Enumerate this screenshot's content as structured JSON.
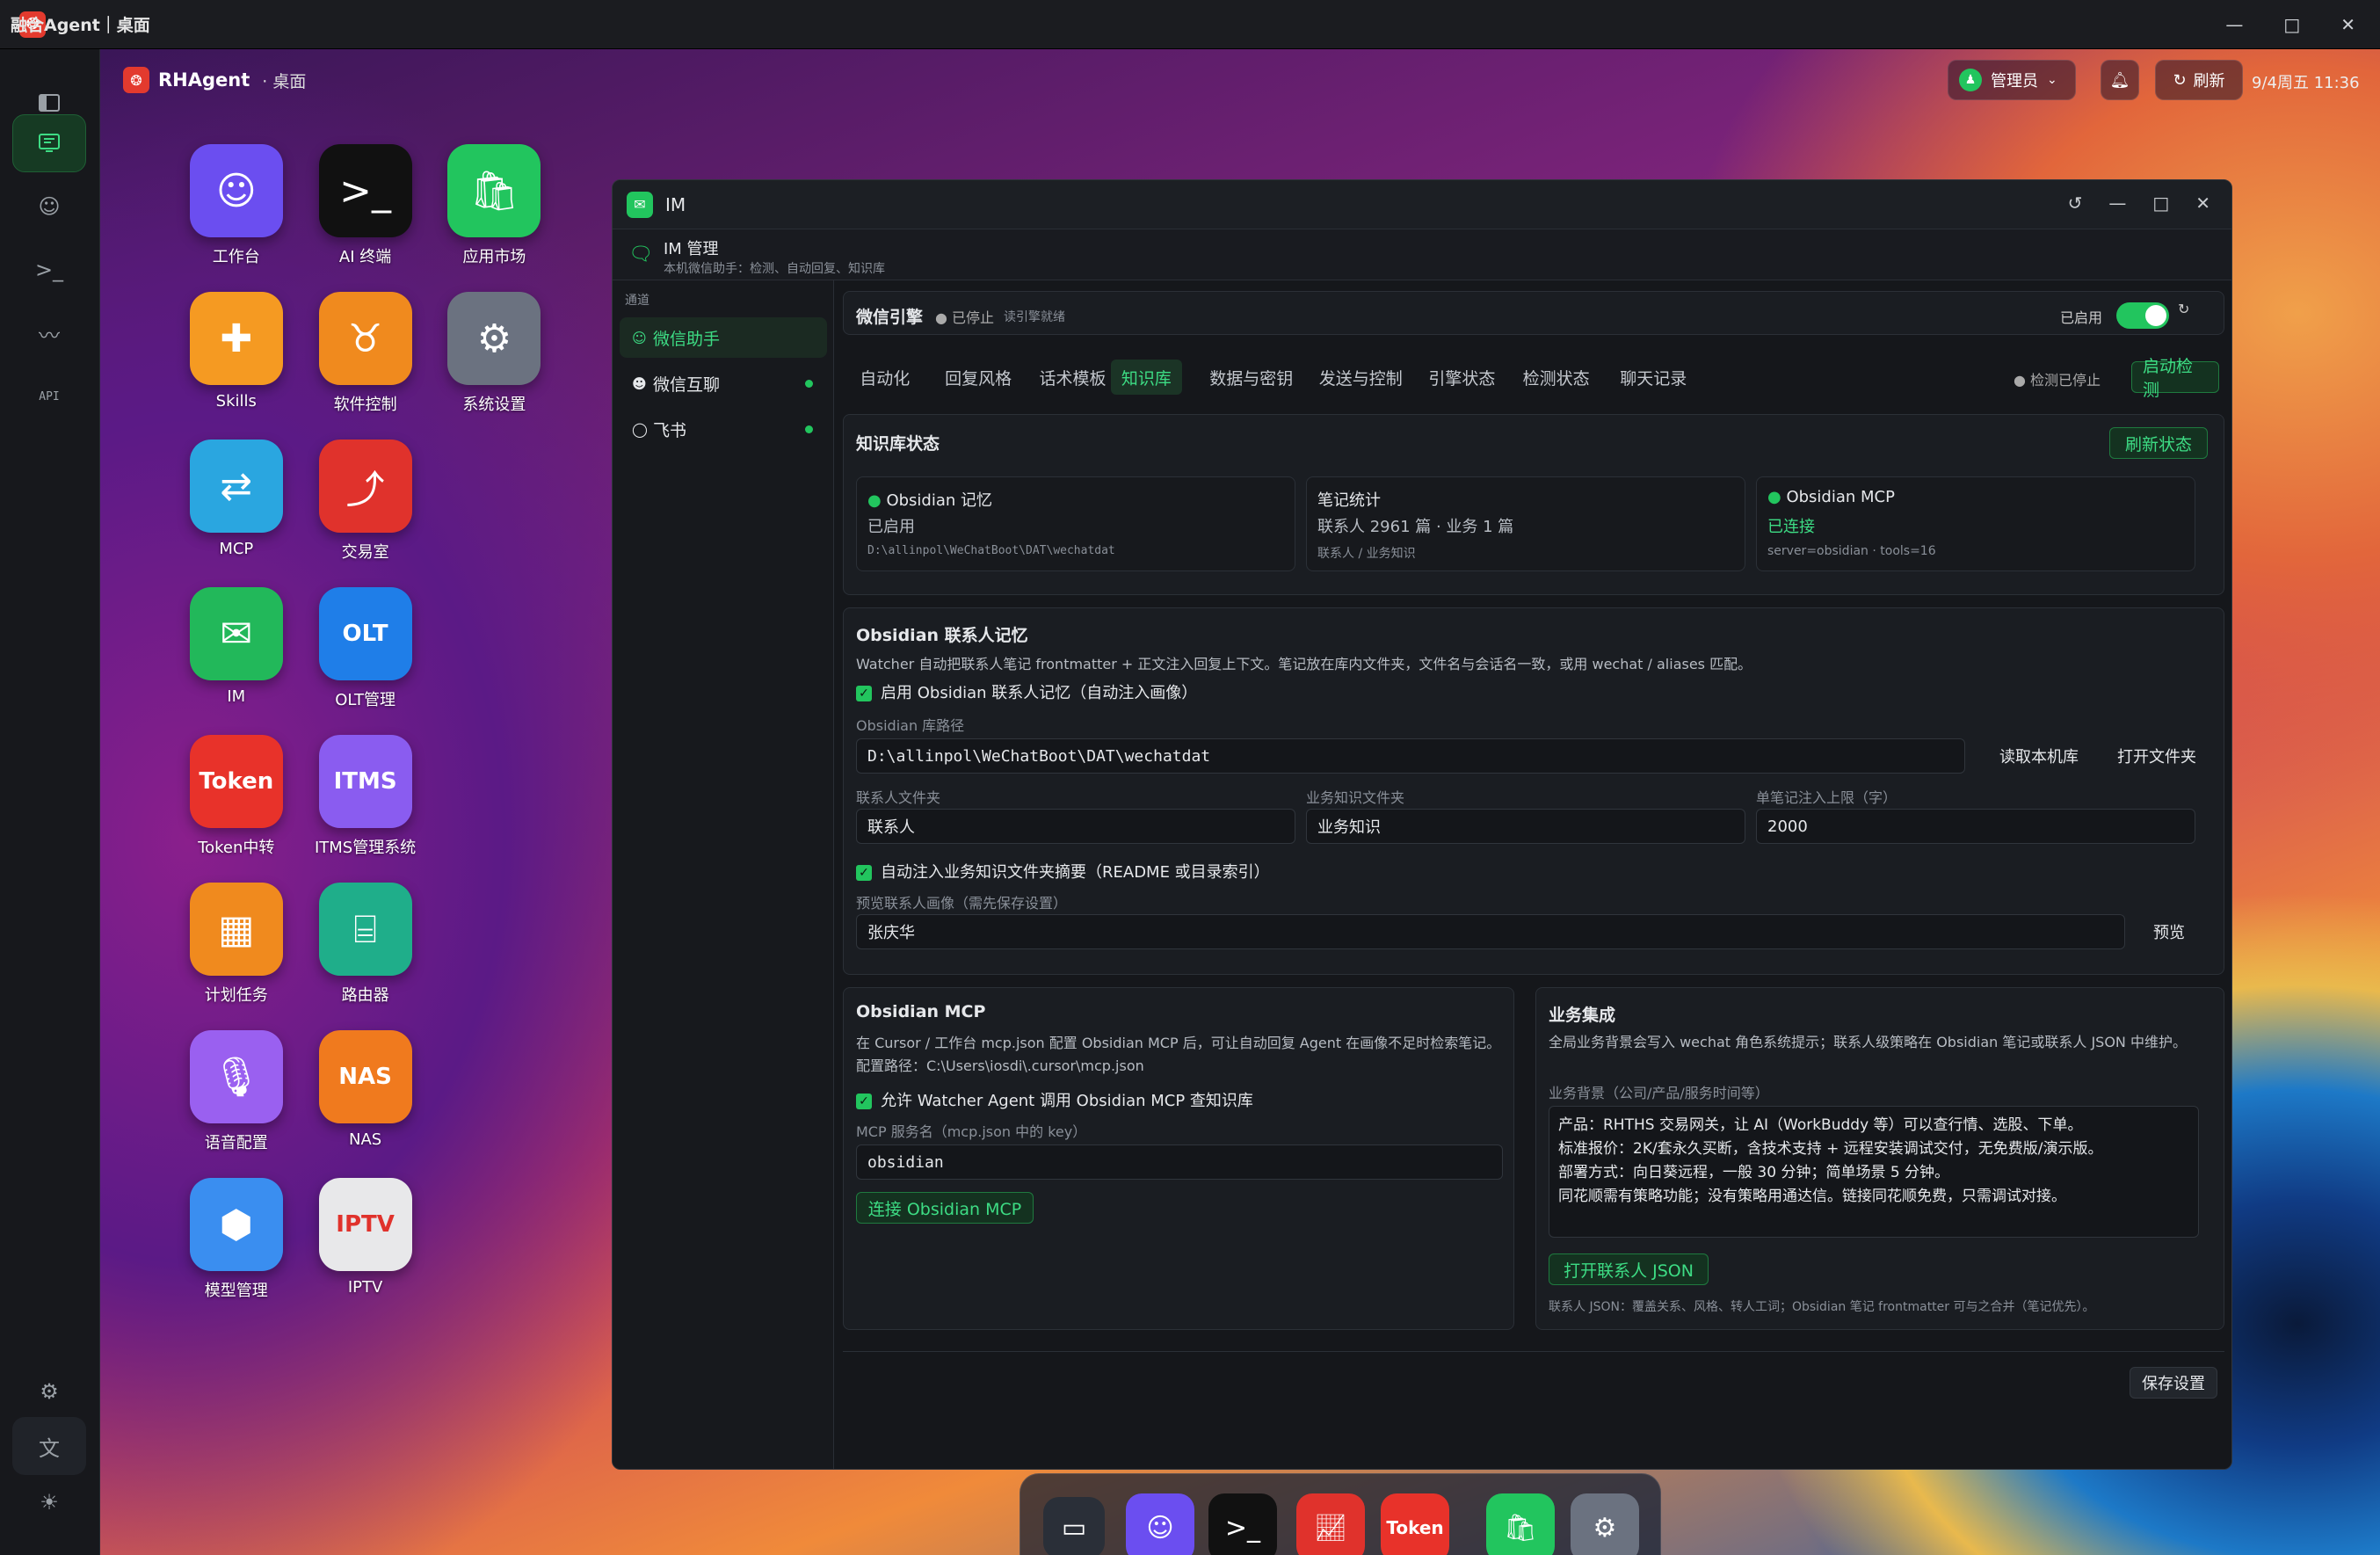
{
  "app": {
    "title": "融合Agent｜桌面",
    "brand": "RHAgent",
    "crumb_sep": "·",
    "crumb": "桌面"
  },
  "window_controls": {
    "min": "—",
    "max": "□",
    "close": "✕"
  },
  "topbar": {
    "user": "管理员",
    "refresh": "刷新",
    "datetime": "9/4周五 11:36"
  },
  "rail": {
    "api_label": "API"
  },
  "desktop_icons": [
    {
      "label": "工作台",
      "icon": "robot-icon",
      "color": "#6b4ef0"
    },
    {
      "label": "AI 终端",
      "icon": "terminal-icon",
      "color": "#111111"
    },
    {
      "label": "应用市场",
      "icon": "shopping-bag-icon",
      "color": "#22c55e"
    },
    {
      "label": "Skills",
      "icon": "puzzle-icon",
      "color": "#f59a22"
    },
    {
      "label": "软件控制",
      "icon": "bull-icon",
      "color": "#f08a1e"
    },
    {
      "label": "系统设置",
      "icon": "gear-icon",
      "color": "#6b7280"
    },
    {
      "label": "MCP",
      "icon": "mcp-icon",
      "color": "#2aa6e0"
    },
    {
      "label": "交易室",
      "icon": "chart-up-icon",
      "color": "#e0322c"
    },
    {
      "label": "IM",
      "icon": "wechat-icon",
      "color": "#22b85a"
    },
    {
      "label": "OLT管理",
      "icon": "olt-icon",
      "color": "#1f7ee8"
    },
    {
      "label": "Token中转",
      "icon": "token-icon",
      "color": "#e8322a"
    },
    {
      "label": "ITMS管理系统",
      "icon": "itms-icon",
      "color": "#8a5cf0"
    },
    {
      "label": "计划任务",
      "icon": "calendar-icon",
      "color": "#f08a1e"
    },
    {
      "label": "路由器",
      "icon": "router-icon",
      "color": "#1fae8a"
    },
    {
      "label": "语音配置",
      "icon": "microphone-icon",
      "color": "#9a60f0"
    },
    {
      "label": "NAS",
      "icon": "nas-icon",
      "color": "#f07a1e"
    },
    {
      "label": "模型管理",
      "icon": "cube-icon",
      "color": "#3a8ef0"
    },
    {
      "label": "IPTV",
      "icon": "iptv-icon",
      "color": "#e8e8ea"
    }
  ],
  "icon_text": {
    "olt": "OLT",
    "token": "Token",
    "itms": "ITMS",
    "nas": "NAS",
    "iptv": "IPTV"
  },
  "im_window": {
    "title": "IM",
    "sub_title": "IM 管理",
    "sub_desc": "本机微信助手：检测、自动回复、知识库",
    "sidebar_caption": "通道",
    "channels": [
      "微信助手",
      "微信互聊",
      "飞书"
    ],
    "engine": {
      "name": "微信引擎",
      "status": "已停止",
      "ready": "读引擎就绪",
      "enabled_label": "已启用"
    },
    "tabs": [
      "自动化",
      "回复风格",
      "话术模板",
      "知识库",
      "数据与密钥",
      "发送与控制",
      "引擎状态",
      "检测状态",
      "聊天记录"
    ],
    "detect_status": "检测已停止",
    "start_detect": "启动检测",
    "kb_status": {
      "title": "知识库状态",
      "refresh": "刷新状态",
      "cards": [
        {
          "title": "Obsidian 记忆",
          "status": "已启用",
          "detail": "D:\\allinpol\\WeChatBoot\\DAT\\wechatdat"
        },
        {
          "title": "笔记统计",
          "status": "联系人 2961 篇 · 业务 1 篇",
          "detail": "联系人 / 业务知识"
        },
        {
          "title": "Obsidian MCP",
          "status": "已连接",
          "detail": "server=obsidian · tools=16"
        }
      ]
    },
    "contact_mem": {
      "title": "Obsidian 联系人记忆",
      "desc": "Watcher 自动把联系人笔记 frontmatter + 正文注入回复上下文。笔记放在库内文件夹，文件名与会话名一致，或用 wechat / aliases 匹配。",
      "enable_label": "启用 Obsidian 联系人记忆（自动注入画像）",
      "vault_label": "Obsidian 库路径",
      "vault_value": "D:\\allinpol\\WeChatBoot\\DAT\\wechatdat",
      "read_vault": "读取本机库",
      "open_folder": "打开文件夹",
      "contact_folder_label": "联系人文件夹",
      "contact_folder_value": "联系人",
      "biz_folder_label": "业务知识文件夹",
      "biz_folder_value": "业务知识",
      "limit_label": "单笔记注入上限（字）",
      "limit_value": "2000",
      "auto_inject_label": "自动注入业务知识文件夹摘要（README 或目录索引）",
      "preview_label": "预览联系人画像（需先保存设置）",
      "preview_value": "张庆华",
      "preview_btn": "预览"
    },
    "mcp": {
      "title": "Obsidian MCP",
      "desc": "在 Cursor / 工作台 mcp.json 配置 Obsidian MCP 后，可让自动回复 Agent 在画像不足时检索笔记。 配置路径：C:\\Users\\iosdi\\.cursor\\mcp.json",
      "allow_label": "允许 Watcher Agent 调用 Obsidian MCP 查知识库",
      "name_label": "MCP 服务名（mcp.json 中的 key）",
      "name_value": "obsidian",
      "connect": "连接 Obsidian MCP"
    },
    "biz": {
      "title": "业务集成",
      "desc": "全局业务背景会写入 wechat 角色系统提示；联系人级策略在 Obsidian 笔记或联系人 JSON 中维护。",
      "bg_label": "业务背景（公司/产品/服务时间等）",
      "bg_lines": [
        "产品：RHTHS 交易网关，让 AI（WorkBuddy 等）可以查行情、选股、下单。",
        "标准报价：2K/套永久买断，含技术支持 + 远程安装调试交付，无免费版/演示版。",
        "部署方式：向日葵远程，一般 30 分钟；简单场景 5 分钟。",
        "同花顺需有策略功能；没有策略用通达信。链接同花顺免费，只需调试对接。"
      ],
      "open_json": "打开联系人 JSON",
      "foot": "联系人 JSON：覆盖关系、风格、转人工词；Obsidian 笔记 frontmatter 可与之合并（笔记优先）。"
    },
    "save": "保存设置"
  }
}
